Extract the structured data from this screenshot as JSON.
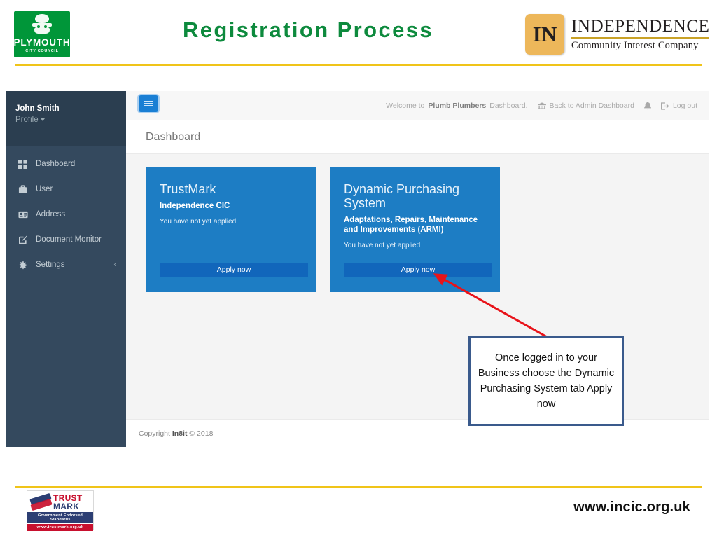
{
  "slide": {
    "title": "Registration Process",
    "title_color": "#0d8a3d",
    "rule_color": "#f0c419"
  },
  "brand_left": {
    "name": "PLYMOUTH",
    "subtitle": "CITY COUNCIL",
    "bg_color": "#009639",
    "icon": "plymouth-coat-of-arms-icon"
  },
  "brand_right": {
    "badge_text": "IN",
    "badge_color": "#edb75a",
    "name": "INDEPENDENCE",
    "tagline": "Community Interest Company",
    "rule_color": "#c9a227"
  },
  "app": {
    "sidebar": {
      "user_name": "John Smith",
      "profile_label": "Profile",
      "bg_color": "#34495e",
      "header_bg_color": "#2b3e50",
      "items": [
        {
          "label": "Dashboard",
          "icon": "grid-icon",
          "has_submenu": false
        },
        {
          "label": "User",
          "icon": "briefcase-icon",
          "has_submenu": false
        },
        {
          "label": "Address",
          "icon": "id-card-icon",
          "has_submenu": false
        },
        {
          "label": "Document Monitor",
          "icon": "pencil-square-icon",
          "has_submenu": false
        },
        {
          "label": "Settings",
          "icon": "gear-icon",
          "has_submenu": true,
          "submenu_glyph": "‹"
        }
      ]
    },
    "topbar": {
      "menu_toggle_icon": "hamburger-icon",
      "menu_toggle_color": "#1a7fd4",
      "welcome_prefix": "Welcome to",
      "welcome_business": "Plumb Plumbers",
      "welcome_suffix": "Dashboard.",
      "back_link": "Back to Admin Dashboard",
      "back_icon": "bank-icon",
      "notifications_icon": "bell-icon",
      "logout_label": "Log out",
      "logout_icon": "sign-out-icon"
    },
    "page_title": "Dashboard",
    "cards": [
      {
        "title": "TrustMark",
        "subtitle": "Independence CIC",
        "status": "You have not yet applied",
        "button_label": "Apply now",
        "bg_color": "#1d7dc4",
        "button_color": "#1166bb"
      },
      {
        "title": "Dynamic Purchasing System",
        "subtitle": "Adaptations, Repairs, Maintenance and Improvements (ARMI)",
        "status": "You have not yet applied",
        "button_label": "Apply now",
        "bg_color": "#1d7dc4",
        "button_color": "#1166bb"
      }
    ],
    "footer": {
      "copyright_prefix": "Copyright",
      "copyright_brand": "In8it",
      "copyright_suffix": "© 2018"
    }
  },
  "annotation": {
    "text": "Once logged in to your Business choose the Dynamic Purchasing System tab Apply now",
    "border_color": "#3a5a8c",
    "arrow_color": "#e8131a"
  },
  "footer": {
    "trustmark": {
      "word1": "TRUST",
      "word2": "MARK",
      "band": "Government Endorsed Standards",
      "url": "www.trustmark.org.uk",
      "icon": "handshake-icon"
    },
    "website": "www.incic.org.uk"
  }
}
